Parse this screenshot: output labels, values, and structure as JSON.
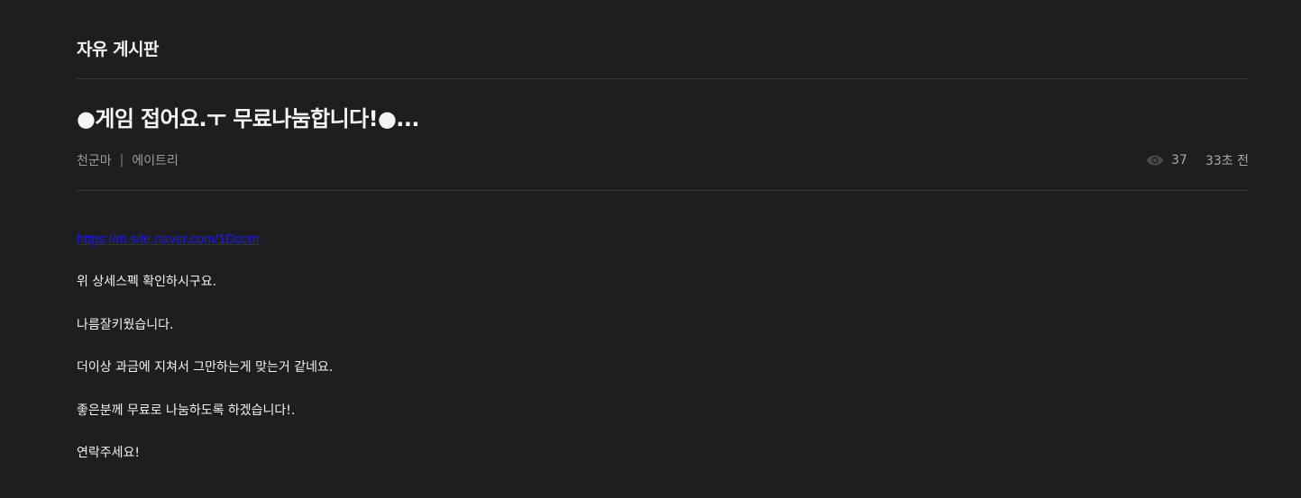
{
  "board": {
    "title": "자유 게시판"
  },
  "post": {
    "title": "●게임 접어요.ㅜ 무료나눔합니다!●...",
    "author": "천군마",
    "separator": "|",
    "category": "에이트리",
    "views": "37",
    "time": "33초 전",
    "icon": "eye-icon",
    "link": "https://m.site.naver.com/1Dccm",
    "body": [
      "위 상세스펙 확인하시구요.",
      "나름잘키웠습니다.",
      "더이상 과금에 지쳐서 그만하는게 맞는거 같네요.",
      "좋은분께 무료로 나눔하도록 하겠습니다!.",
      "연락주세요!"
    ]
  },
  "colors": {
    "background": "#1e1e21",
    "link": "#1b1bf0",
    "divider": "#38383c"
  }
}
